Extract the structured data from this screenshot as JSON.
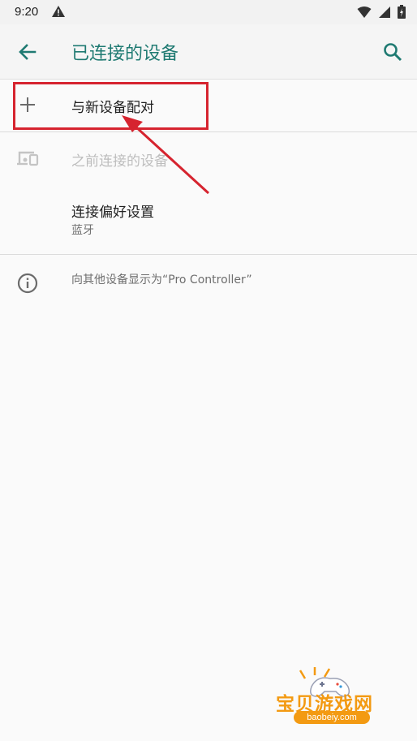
{
  "status_bar": {
    "time": "9:20",
    "icons": [
      "warning-icon",
      "wifi-icon",
      "signal-icon",
      "battery-icon"
    ]
  },
  "app_bar": {
    "title": "已连接的设备",
    "accent_color": "#1f7a72"
  },
  "items": {
    "pair_new": {
      "label": "与新设备配对",
      "icon": "plus-icon"
    },
    "previously_connected": {
      "label": "之前连接的设备",
      "icon": "devices-icon",
      "enabled": false
    },
    "connection_prefs": {
      "label": "连接偏好设置",
      "summary": "蓝牙"
    },
    "visibility_info": {
      "label": "向其他设备显示为“Pro Controller”",
      "icon": "info-icon"
    }
  },
  "annotation": {
    "highlight_color": "#d6242f"
  },
  "watermark": {
    "text": "宝贝游戏网",
    "url": "baobeiy.com",
    "color": "#f39a12"
  }
}
